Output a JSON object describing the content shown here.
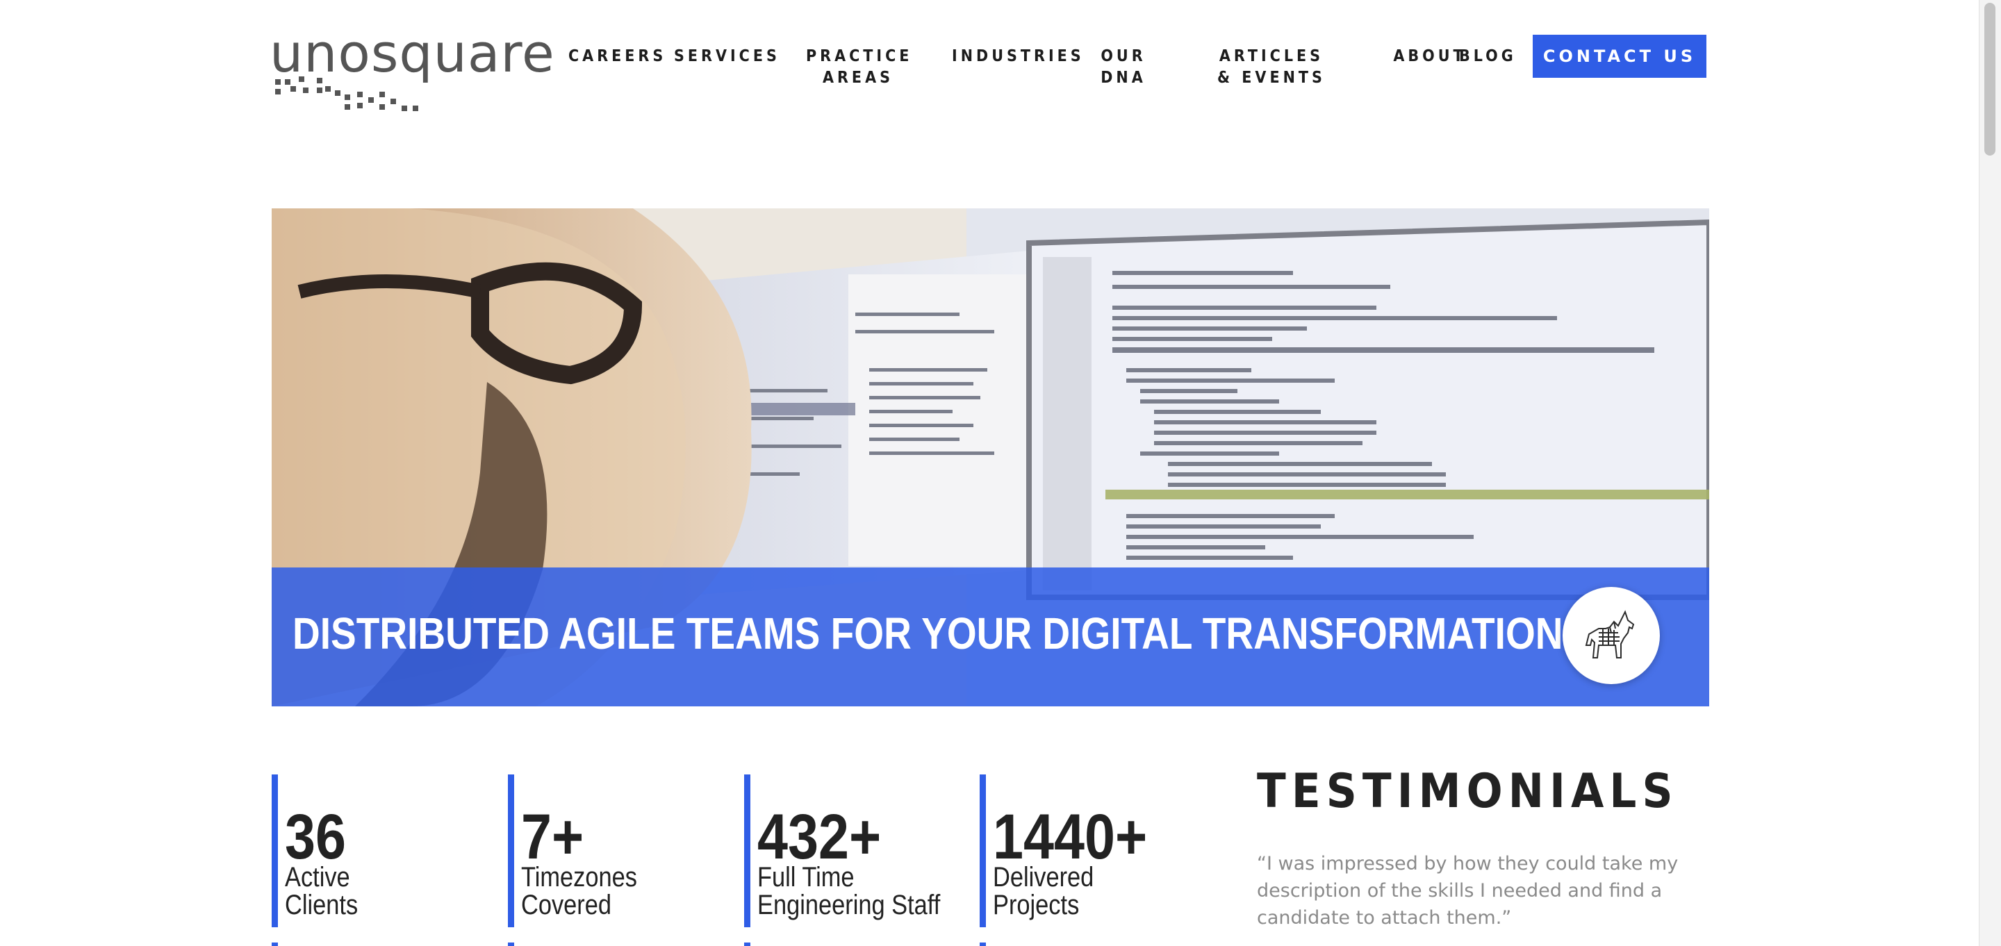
{
  "brand": {
    "logo_text": "unosquare"
  },
  "nav": {
    "items": [
      {
        "label": "CAREERS"
      },
      {
        "label": "SERVICES"
      },
      {
        "label": "PRACTICE AREAS"
      },
      {
        "label": "INDUSTRIES"
      },
      {
        "label": "OUR DNA"
      },
      {
        "label": "ARTICLES & EVENTS"
      },
      {
        "label": "ABOUT"
      },
      {
        "label": "BLOG"
      }
    ],
    "cta_label": "CONTACT US"
  },
  "hero": {
    "title": "DISTRIBUTED AGILE TEAMS FOR YOUR DIGITAL TRANSFORMATION",
    "badge_icon": "unicorn-icon"
  },
  "stats": [
    {
      "value": "36",
      "label_line1": "Active",
      "label_line2": "Clients"
    },
    {
      "value": "7+",
      "label_line1": "Timezones",
      "label_line2": "Covered"
    },
    {
      "value": "432+",
      "label_line1": "Full Time",
      "label_line2": "Engineering Staff"
    },
    {
      "value": "1440+",
      "label_line1": "Delivered",
      "label_line2": "Projects"
    }
  ],
  "testimonials": {
    "heading": "TESTIMONIALS",
    "quote": "“I was impressed by how they could take my description of the skills I needed and find a candidate to attach them.”"
  },
  "colors": {
    "accent": "#2f5de6",
    "text_dark": "#222222",
    "text_muted": "#8a8a8a"
  }
}
